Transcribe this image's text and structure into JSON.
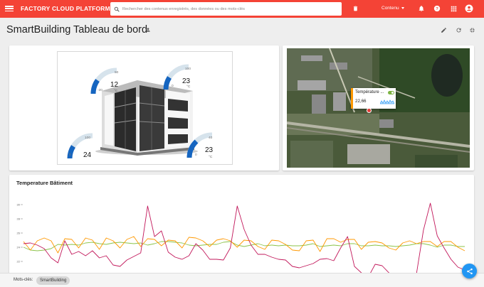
{
  "header": {
    "brand": "FACTORY CLOUD PLATFORM",
    "search_placeholder": "Rechercher des contenus enregistrés, des données ou des mots-clés",
    "content_menu": "Contenu",
    "icons": [
      "menu-icon",
      "search-icon",
      "delete-icon",
      "notifications-icon",
      "help-icon",
      "apps-icon",
      "account-icon"
    ]
  },
  "page": {
    "title": "SmartBuilding Tableau de bord",
    "icons": [
      "person-icon",
      "edit-icon",
      "refresh-icon",
      "collapse-icon"
    ]
  },
  "building_widget": {
    "gauges": [
      {
        "value": "12",
        "min": "-20",
        "max": "50",
        "unit": "°C"
      },
      {
        "value": "23",
        "min": "0",
        "max": "100",
        "unit": "°C"
      },
      {
        "value": "24",
        "min": "0",
        "max": "100",
        "unit": ""
      },
      {
        "value": "23",
        "min": "0",
        "max": "40",
        "unit": "°C"
      }
    ]
  },
  "map_widget": {
    "tooltip_label": "Température ...",
    "tooltip_value": "22,66",
    "colors": {
      "tooltip_accent": "#ff9800",
      "toggle": "#7cb342",
      "marker": "#e53935"
    }
  },
  "chart_data": {
    "type": "line",
    "title": "Temperature Bâtiment",
    "xlabel": "",
    "ylabel": "",
    "ylim": [
      20,
      30
    ],
    "yticks": [
      "30",
      "28",
      "26",
      "24",
      "22",
      "20"
    ],
    "x": [
      0,
      1,
      2,
      3,
      4,
      5,
      6,
      7,
      8,
      9,
      10,
      11,
      12,
      13,
      14,
      15,
      16,
      17,
      18,
      19,
      20,
      21,
      22,
      23,
      24,
      25,
      26,
      27,
      28,
      29,
      30,
      31,
      32,
      33,
      34,
      35,
      36,
      37,
      38,
      39,
      40,
      41,
      42,
      43,
      44,
      45,
      46,
      47,
      48,
      49,
      50,
      51,
      52,
      53,
      54,
      55,
      56,
      57,
      58,
      59,
      60,
      61,
      62,
      63,
      64
    ],
    "series": [
      {
        "color": "#8bc34a",
        "values": [
          24.0,
          23.6,
          23.5,
          23.6,
          23.8,
          24.4,
          24.3,
          24.4,
          24.3,
          24.6,
          24.7,
          24.5,
          24.4,
          24.6,
          24.7,
          24.6,
          24.5,
          24.6,
          24.3,
          24.5,
          24.8,
          24.8,
          24.7,
          24.6,
          24.3,
          24.2,
          24.3,
          24.4,
          24.4,
          24.7,
          24.8,
          24.3,
          24.1,
          24.3,
          24.5,
          24.2,
          24.3,
          24.2,
          24.3,
          24.2,
          24.2,
          24.3,
          24.5,
          24.1,
          24.2,
          24.3,
          24.2,
          24.5,
          24.5,
          24.2,
          24.2,
          24.3,
          24.2,
          24.2,
          24.1,
          24.2,
          24.3,
          24.5,
          24.5,
          24.3,
          24.0,
          24.3,
          24.3,
          24.1,
          24.1
        ]
      },
      {
        "color": "#ff9800",
        "values": [
          24.8,
          23.6,
          24.9,
          25.3,
          24.9,
          23.2,
          25.2,
          25.1,
          23.9,
          25.3,
          25.0,
          23.7,
          25.3,
          24.9,
          23.9,
          25.1,
          25.5,
          24.1,
          25.2,
          25.1,
          24.2,
          25.0,
          24.9,
          23.9,
          25.4,
          25.3,
          24.9,
          24.1,
          25.0,
          25.2,
          24.9,
          24.0,
          25.0,
          24.9,
          24.1,
          23.7,
          25.0,
          24.9,
          24.4,
          23.6,
          23.5,
          24.9,
          25.0,
          23.4,
          25.2,
          25.2,
          24.7,
          25.1,
          25.1,
          23.7,
          24.7,
          24.8,
          24.6,
          23.9,
          23.6,
          24.6,
          24.9,
          24.5,
          24.8,
          24.8,
          24.1,
          24.8,
          24.8,
          24.0,
          23.5
        ]
      },
      {
        "color": "#c2185b",
        "values": [
          24.5,
          24.6,
          24.3,
          23.8,
          22.5,
          21.8,
          24.9,
          23.0,
          23.4,
          22.8,
          23.5,
          22.5,
          22.8,
          21.5,
          21.3,
          22.2,
          22.7,
          23.2,
          29.8,
          25.5,
          26.3,
          23.3,
          22.6,
          22.3,
          22.8,
          24.5,
          23.6,
          22.3,
          22.3,
          22.2,
          23.9,
          29.8,
          26.5,
          24.3,
          23.0,
          23.0,
          22.6,
          22.3,
          22.2,
          21.3,
          21.1,
          21.4,
          21.7,
          22.3,
          22.4,
          22.1,
          23.9,
          25.5,
          21.3,
          20.4,
          19.8,
          21.6,
          21.4,
          20.4,
          19.9,
          19.8,
          20.3,
          20.3,
          26.4,
          30.2,
          25.6,
          23.9,
          22.3,
          21.2,
          20.8
        ]
      }
    ]
  },
  "footer": {
    "tags_label": "Mots-clés:",
    "tag": "SmartBuilding"
  }
}
